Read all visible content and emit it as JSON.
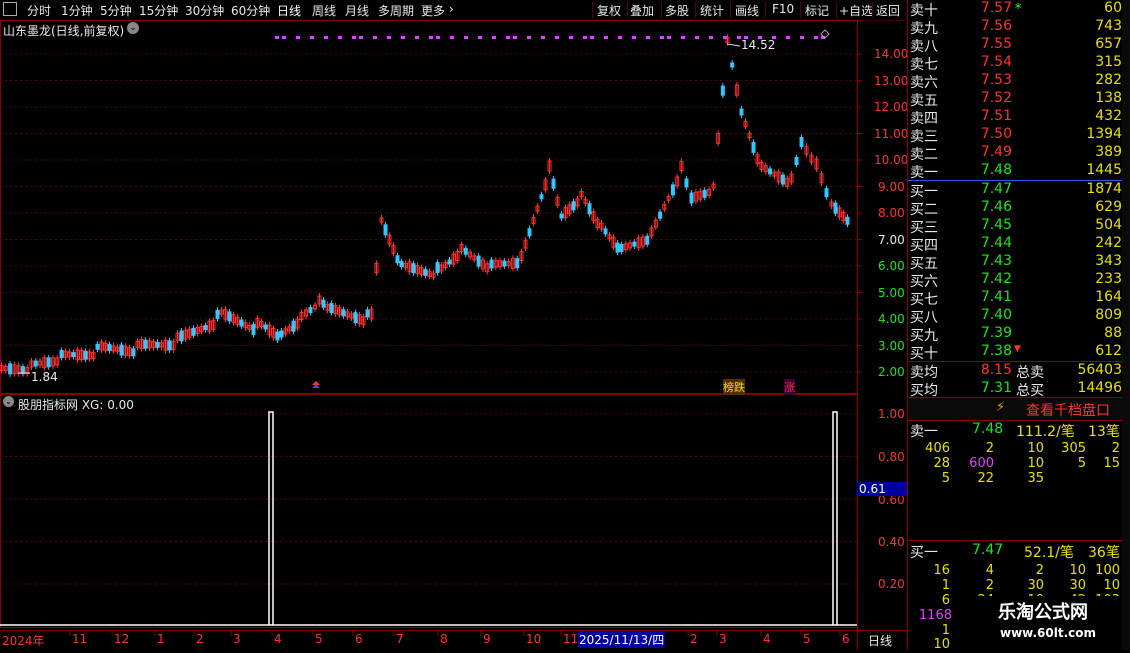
{
  "toolbar": {
    "left_icon": "square-icon",
    "tabs": [
      "分时",
      "1分钟",
      "5分钟",
      "15分钟",
      "30分钟",
      "60分钟",
      "日线",
      "周线",
      "月线",
      "多周期",
      "更多"
    ],
    "active_tab": "日线",
    "right_buttons": [
      "复权",
      "叠加",
      "多股",
      "统计",
      "画线",
      "F10",
      "标记",
      "+自选",
      "返回"
    ]
  },
  "main_chart": {
    "title": "山东墨龙(日线,前复权)",
    "high_label": "14.52",
    "low_label": "1.84",
    "yaxis_ticks": [
      "14.00",
      "13.00",
      "12.00",
      "11.00",
      "10.00",
      "9.00",
      "8.00",
      "7.00",
      "6.00",
      "5.00",
      "4.00",
      "3.00",
      "2.00"
    ],
    "markers": [
      "榜跌",
      "涨"
    ]
  },
  "indicator": {
    "title": "股朋指标网 XG: 0.00",
    "yaxis_ticks": [
      "1.00",
      "0.80",
      "0.60",
      "0.40",
      "0.20"
    ],
    "current_value": "0.61"
  },
  "xaxis": {
    "labels": [
      "2024年",
      "11",
      "12",
      "1",
      "2",
      "3",
      "4",
      "5",
      "6",
      "7",
      "8",
      "9",
      "10",
      "11",
      "2025/11/13/四",
      "2",
      "3",
      "4",
      "5",
      "6"
    ],
    "period_label": "日线"
  },
  "order_book": {
    "asks": [
      {
        "name": "卖十",
        "price": "7.57",
        "vol": "60"
      },
      {
        "name": "卖九",
        "price": "7.56",
        "vol": "743"
      },
      {
        "name": "卖八",
        "price": "7.55",
        "vol": "657"
      },
      {
        "name": "卖七",
        "price": "7.54",
        "vol": "315"
      },
      {
        "name": "卖六",
        "price": "7.53",
        "vol": "282"
      },
      {
        "name": "卖五",
        "price": "7.52",
        "vol": "138"
      },
      {
        "name": "卖四",
        "price": "7.51",
        "vol": "432"
      },
      {
        "name": "卖三",
        "price": "7.50",
        "vol": "1394"
      },
      {
        "name": "卖二",
        "price": "7.49",
        "vol": "389"
      },
      {
        "name": "卖一",
        "price": "7.48",
        "vol": "1445"
      }
    ],
    "bids": [
      {
        "name": "买一",
        "price": "7.47",
        "vol": "1874"
      },
      {
        "name": "买二",
        "price": "7.46",
        "vol": "629"
      },
      {
        "name": "买三",
        "price": "7.45",
        "vol": "504"
      },
      {
        "name": "买四",
        "price": "7.44",
        "vol": "242"
      },
      {
        "name": "买五",
        "price": "7.43",
        "vol": "343"
      },
      {
        "name": "买六",
        "price": "7.42",
        "vol": "233"
      },
      {
        "name": "买七",
        "price": "7.41",
        "vol": "164"
      },
      {
        "name": "买八",
        "price": "7.40",
        "vol": "809"
      },
      {
        "name": "买九",
        "price": "7.39",
        "vol": "88"
      },
      {
        "name": "买十",
        "price": "7.38",
        "vol": "612"
      }
    ],
    "ask_avg_label": "卖均",
    "ask_avg": "8.15",
    "total_sell_label": "总卖",
    "total_sell": "56403",
    "bid_avg_label": "买均",
    "bid_avg": "7.31",
    "total_buy_label": "总买",
    "total_buy": "14496"
  },
  "depth": {
    "button_label": "查看千档盘口",
    "sell1": {
      "name": "卖一",
      "price": "7.48",
      "avg": "111.2/笔",
      "count": "13笔"
    },
    "sell_queue": [
      [
        "406",
        "2",
        "10",
        "305",
        "2"
      ],
      [
        "28",
        "600",
        "10",
        "5",
        "15"
      ],
      [
        "5",
        "22",
        "35",
        "",
        ""
      ]
    ],
    "buy1": {
      "name": "买一",
      "price": "7.47",
      "avg": "52.1/笔",
      "count": "36笔"
    },
    "buy_queue": [
      [
        "16",
        "4",
        "2",
        "10",
        "100"
      ],
      [
        "1",
        "2",
        "30",
        "30",
        "10"
      ],
      [
        "6",
        "24",
        "10",
        "42",
        "103"
      ]
    ],
    "buy_extra": [
      "1168",
      "1",
      "10"
    ]
  },
  "watermark": {
    "title": "乐淘公式网",
    "url": "www.60lt.com"
  },
  "colors": {
    "up": "#ff3030",
    "down": "#19e619",
    "grid": "#5a0000",
    "bg": "#000000",
    "magenta": "#e040ff",
    "cyan": "#30c8ff"
  }
}
